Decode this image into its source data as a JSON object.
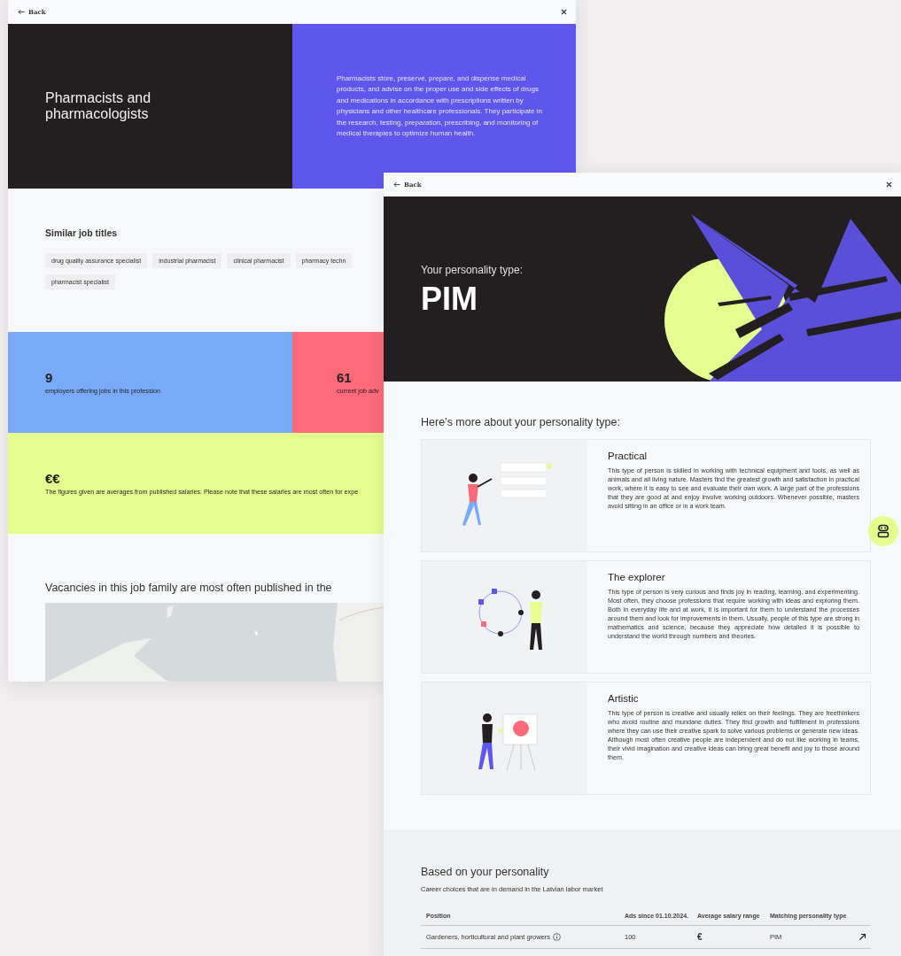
{
  "left_window": {
    "back": "Back",
    "title": "Pharmacists and pharmacologists",
    "description": "Pharmacists store, preserve, prepare, and dispense medical products, and advise on the proper use and side effects of drugs and medications in accordance with prescriptions written by physicians and other healthcare professionals. They participate in the research, testing, preparation, prescribing, and monitoring of medical therapies to optimize human health.",
    "similar": {
      "heading": "Similar job titles",
      "chip_rows": [
        [
          "drug quality assurance specialist",
          "industrial pharmacist",
          "clinical pharmacist",
          "pharmacy techn"
        ],
        [
          "pharmacist specialist"
        ]
      ]
    },
    "stats": [
      {
        "value": "9",
        "label": "employers offering jobs in this profession",
        "color": "#78aaf7"
      },
      {
        "value": "61",
        "label": "current job adv",
        "color": "#fd6a78"
      }
    ],
    "salary": {
      "value": "€€",
      "note": "The figures given are averages from published salaries. Please note that these salaries are most often for expe"
    },
    "vacancies": {
      "heading": "Vacancies in this job family are most often published in the"
    }
  },
  "right_window": {
    "back": "Back",
    "eyebrow": "Your personality type:",
    "type": "PIM",
    "section_heading": "Here’s more about your personality type:",
    "cards": [
      {
        "title": "Practical",
        "text": "This type of person is skilled in working with technical equipment and tools, as well as animals and all living nature. Masters find the greatest growth and satisfaction in practical work, where it is easy to see and evaluate their own work. A large part of the professions that they are good at and enjoy involve working outdoors. Whenever possible, masters avoid sitting in an office or in a work team."
      },
      {
        "title": "The explorer",
        "text": "This type of person is very curious and finds joy in reading, learning, and experimenting. Most often, they choose professions that require working with ideas and exploring them. Both in everyday life and at work, it is important for them to understand the processes around them and look for improvements in them. Usually, people of this type are strong in mathematics and science, because they appreciate how detailed it is possible to understand the world through numbers and theories."
      },
      {
        "title": "Artistic",
        "text": "This type of person is creative and usually relies on their feelings. They are freethinkers who avoid routine and mundane duties. They find growth and fulfillment in professions where they can use their creative spark to solve various problems or generate new ideas. Although most often creative people are independent and do not like working in teams, their vivid imagination and creative ideas can bring great benefit and joy to those around them."
      }
    ],
    "careers": {
      "heading": "Based on your personality",
      "subtitle": "Career choices that are in demand in the Latvian labor market",
      "columns": [
        "Position",
        "Ads since 01.10.2024.",
        "Average salary range",
        "Matching personality type"
      ],
      "rows": [
        {
          "position": "Gardeners, horticultural and plant growers",
          "ads": "100",
          "salary": "€",
          "type": "PIM"
        }
      ]
    }
  }
}
